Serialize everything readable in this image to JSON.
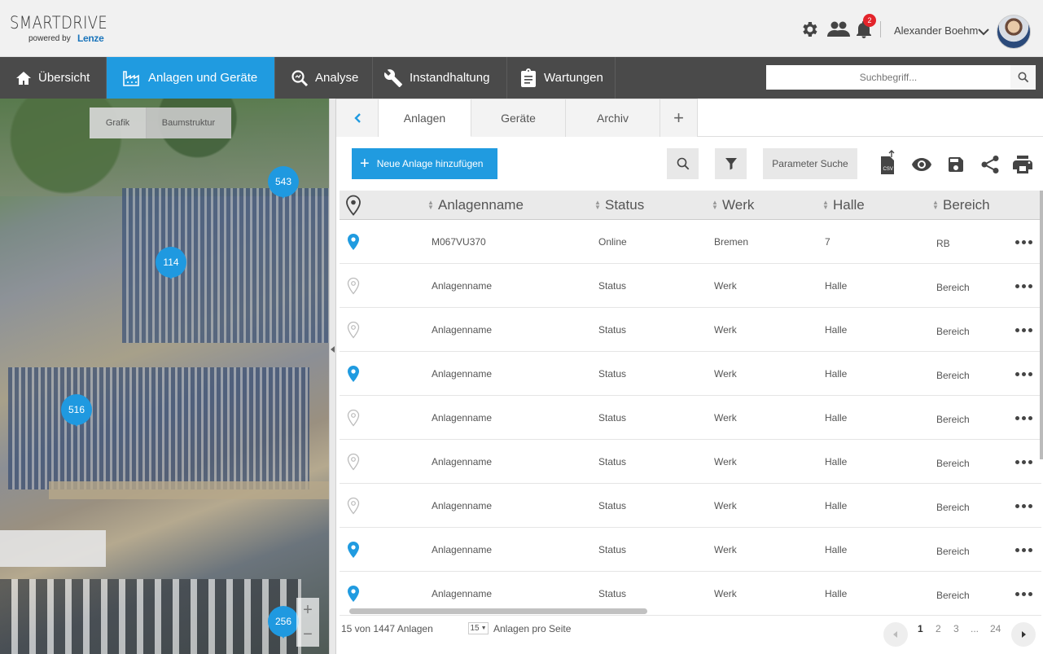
{
  "header": {
    "logo_main": "SMARTDRIVE",
    "logo_sub": "powered by",
    "logo_brand": "Lenze",
    "notification_count": "2",
    "user_name": "Alexander Boehm",
    "icons": [
      "gear-icon",
      "users-icon",
      "bell-icon",
      "chevron-down-icon"
    ]
  },
  "nav": {
    "items": [
      {
        "label": "Übersicht",
        "icon": "home-icon"
      },
      {
        "label": "Anlagen und Geräte",
        "icon": "factory-icon",
        "active": true
      },
      {
        "label": "Analyse",
        "icon": "analysis-icon"
      },
      {
        "label": "Instandhaltung",
        "icon": "wrench-icon"
      },
      {
        "label": "Wartungen",
        "icon": "clipboard-icon"
      }
    ],
    "search_placeholder": "Suchbegriff..."
  },
  "map": {
    "tabs": [
      "Grafik",
      "Baumstruktur"
    ],
    "pins": [
      "543",
      "114",
      "516",
      "256"
    ],
    "zoom_in": "+",
    "zoom_out": "−"
  },
  "panel": {
    "tabs": [
      "Anlagen",
      "Geräte",
      "Archiv"
    ],
    "add_tab": "+",
    "new_button": "Neue Anlage hinzufügen",
    "param_search": "Parameter Suche",
    "csv_label": "CSV",
    "columns": [
      "Anlagenname",
      "Status",
      "Werk",
      "Halle",
      "Bereich"
    ],
    "rows": [
      {
        "pin": "filled",
        "name": "M067VU370",
        "status": "Online",
        "werk": "Bremen",
        "halle": "7",
        "bereich": "RB"
      },
      {
        "pin": "outline",
        "name": "Anlagenname",
        "status": "Status",
        "werk": "Werk",
        "halle": "Halle",
        "bereich": "Bereich"
      },
      {
        "pin": "outline",
        "name": "Anlagenname",
        "status": "Status",
        "werk": "Werk",
        "halle": "Halle",
        "bereich": "Bereich"
      },
      {
        "pin": "filled",
        "name": "Anlagenname",
        "status": "Status",
        "werk": "Werk",
        "halle": "Halle",
        "bereich": "Bereich"
      },
      {
        "pin": "outline",
        "name": "Anlagenname",
        "status": "Status",
        "werk": "Werk",
        "halle": "Halle",
        "bereich": "Bereich"
      },
      {
        "pin": "outline",
        "name": "Anlagenname",
        "status": "Status",
        "werk": "Werk",
        "halle": "Halle",
        "bereich": "Bereich"
      },
      {
        "pin": "outline",
        "name": "Anlagenname",
        "status": "Status",
        "werk": "Werk",
        "halle": "Halle",
        "bereich": "Bereich"
      },
      {
        "pin": "filled",
        "name": "Anlagenname",
        "status": "Status",
        "werk": "Werk",
        "halle": "Halle",
        "bereich": "Bereich"
      },
      {
        "pin": "filled",
        "name": "Anlagenname",
        "status": "Status",
        "werk": "Werk",
        "halle": "Halle",
        "bereich": "Bereich"
      }
    ],
    "footer": {
      "count_text": "15 von 1447 Anlagen",
      "per_page_value": "15",
      "per_page_label": "Anlagen pro Seite",
      "pages": [
        "1",
        "2",
        "3",
        "...",
        "24"
      ],
      "current_page": "1"
    }
  },
  "colors": {
    "accent": "#209be0",
    "nav_bg": "#4a4a4a",
    "badge": "#e3242b"
  }
}
